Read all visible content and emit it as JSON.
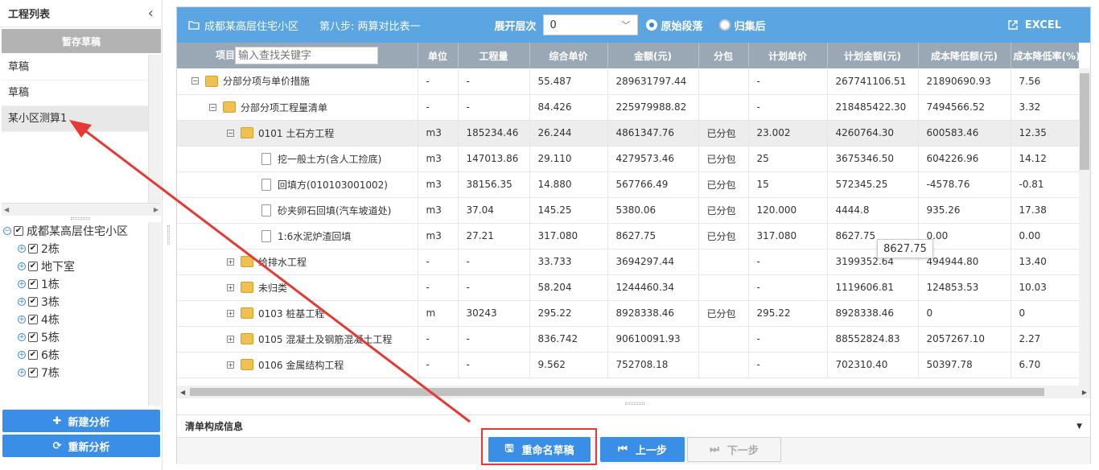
{
  "left_panel": {
    "title": "工程列表",
    "drafts_header": "暂存草稿",
    "drafts": [
      "草稿",
      "草稿",
      "某小区测算1"
    ],
    "tree": {
      "root": "成都某高层住宅小区",
      "children": [
        "2栋",
        "地下室",
        "1栋",
        "3栋",
        "4栋",
        "5栋",
        "6栋",
        "7栋"
      ]
    },
    "new_analysis": "新建分析",
    "reanalyze": "重新分析"
  },
  "toolbar": {
    "project_name": "成都某高层住宅小区",
    "step": "第八步: 两算对比表一",
    "expand_level_label": "展开层次",
    "expand_level_value": "0",
    "radio_original": "原始段落",
    "radio_merged": "归集后",
    "excel": "EXCEL"
  },
  "table": {
    "search_placeholder": "输入查找关键字",
    "columns": [
      "项目",
      "单位",
      "工程量",
      "综合单价",
      "金额(元)",
      "分包",
      "计划单价",
      "计划金额(元)",
      "成本降低额(元)",
      "成本降低率(%)"
    ],
    "rows": [
      {
        "name": "分部分项与单价措施",
        "level": 0,
        "kind": "folder",
        "exp": "⊟",
        "unit": "-",
        "qty": "-",
        "price": "55.487",
        "amount": "289631797.44",
        "sub": "",
        "plan_price": "-",
        "plan_amount": "267741106.51",
        "reduce": "21890690.93",
        "rate": "7.56"
      },
      {
        "name": "分部分项工程量清单",
        "level": 1,
        "kind": "folder",
        "exp": "⊟",
        "unit": "-",
        "qty": "-",
        "price": "84.426",
        "amount": "225979988.82",
        "sub": "",
        "plan_price": "-",
        "plan_amount": "218485422.30",
        "reduce": "7494566.52",
        "rate": "3.32"
      },
      {
        "name": "0101 土石方工程",
        "level": 2,
        "kind": "folder",
        "exp": "⊟",
        "unit": "m3",
        "qty": "185234.46",
        "price": "26.244",
        "amount": "4861347.76",
        "sub": "已分包",
        "plan_price": "23.002",
        "plan_amount": "4260764.30",
        "reduce": "600583.46",
        "rate": "12.35",
        "highlight": true
      },
      {
        "name": "挖一般土方(含人工捡底)",
        "level": 3,
        "kind": "file",
        "exp": "",
        "unit": "m3",
        "qty": "147013.86",
        "price": "29.110",
        "amount": "4279573.46",
        "sub": "已分包",
        "plan_price": "25",
        "plan_amount": "3675346.50",
        "reduce": "604226.96",
        "rate": "14.12"
      },
      {
        "name": "回填方(010103001002)",
        "level": 3,
        "kind": "file",
        "exp": "",
        "unit": "m3",
        "qty": "38156.35",
        "price": "14.880",
        "amount": "567766.49",
        "sub": "已分包",
        "plan_price": "15",
        "plan_amount": "572345.25",
        "reduce": "-4578.76",
        "rate": "-0.81"
      },
      {
        "name": "砂夹卵石回填(汽车坡道处)",
        "level": 3,
        "kind": "file",
        "exp": "",
        "unit": "m3",
        "qty": "37.04",
        "price": "145.25",
        "amount": "5380.06",
        "sub": "已分包",
        "plan_price": "120.000",
        "plan_amount": "4444.8",
        "reduce": "935.26",
        "rate": "17.38"
      },
      {
        "name": "1:6水泥炉渣回填",
        "level": 3,
        "kind": "file",
        "exp": "",
        "unit": "m3",
        "qty": "27.21",
        "price": "317.080",
        "amount": "8627.75",
        "sub": "已分包",
        "plan_price": "317.080",
        "plan_amount": "8627.75",
        "reduce": "0.00",
        "rate": "0.00"
      },
      {
        "name": "给排水工程",
        "level": 2,
        "kind": "folder",
        "exp": "⊞",
        "unit": "-",
        "qty": "-",
        "price": "33.733",
        "amount": "3694297.44",
        "sub": "",
        "plan_price": "-",
        "plan_amount": "3199352.64",
        "reduce": "494944.80",
        "rate": "13.40"
      },
      {
        "name": "未归类",
        "level": 2,
        "kind": "folder",
        "exp": "⊞",
        "unit": "-",
        "qty": "-",
        "price": "58.204",
        "amount": "1244460.34",
        "sub": "",
        "plan_price": "-",
        "plan_amount": "1119606.81",
        "reduce": "124853.53",
        "rate": "10.03"
      },
      {
        "name": "0103 桩基工程",
        "level": 2,
        "kind": "folder",
        "exp": "⊞",
        "unit": "m",
        "qty": "30243",
        "price": "295.22",
        "amount": "8928338.46",
        "sub": "已分包",
        "plan_price": "295.22",
        "plan_amount": "8928338.46",
        "reduce": "0",
        "rate": "0"
      },
      {
        "name": "0105 混凝土及钢筋混凝土工程",
        "level": 2,
        "kind": "folder",
        "exp": "⊞",
        "unit": "-",
        "qty": "-",
        "price": "836.742",
        "amount": "90610091.93",
        "sub": "",
        "plan_price": "-",
        "plan_amount": "88552824.83",
        "reduce": "2057267.10",
        "rate": "2.27"
      },
      {
        "name": "0106 金属结构工程",
        "level": 2,
        "kind": "folder",
        "exp": "⊞",
        "unit": "-",
        "qty": "-",
        "price": "9.562",
        "amount": "752708.18",
        "sub": "",
        "plan_price": "-",
        "plan_amount": "702310.40",
        "reduce": "50397.78",
        "rate": "6.70"
      }
    ]
  },
  "tooltip": "8627.75",
  "detail_title": "清单构成信息",
  "footer": {
    "rename": "重命名草稿",
    "prev": "上一步",
    "next": "下一步"
  },
  "colors": {
    "accent": "#3a8ee6",
    "topbar": "#5aa5e2",
    "header": "#9aa8b5",
    "annotation": "#e53935"
  }
}
